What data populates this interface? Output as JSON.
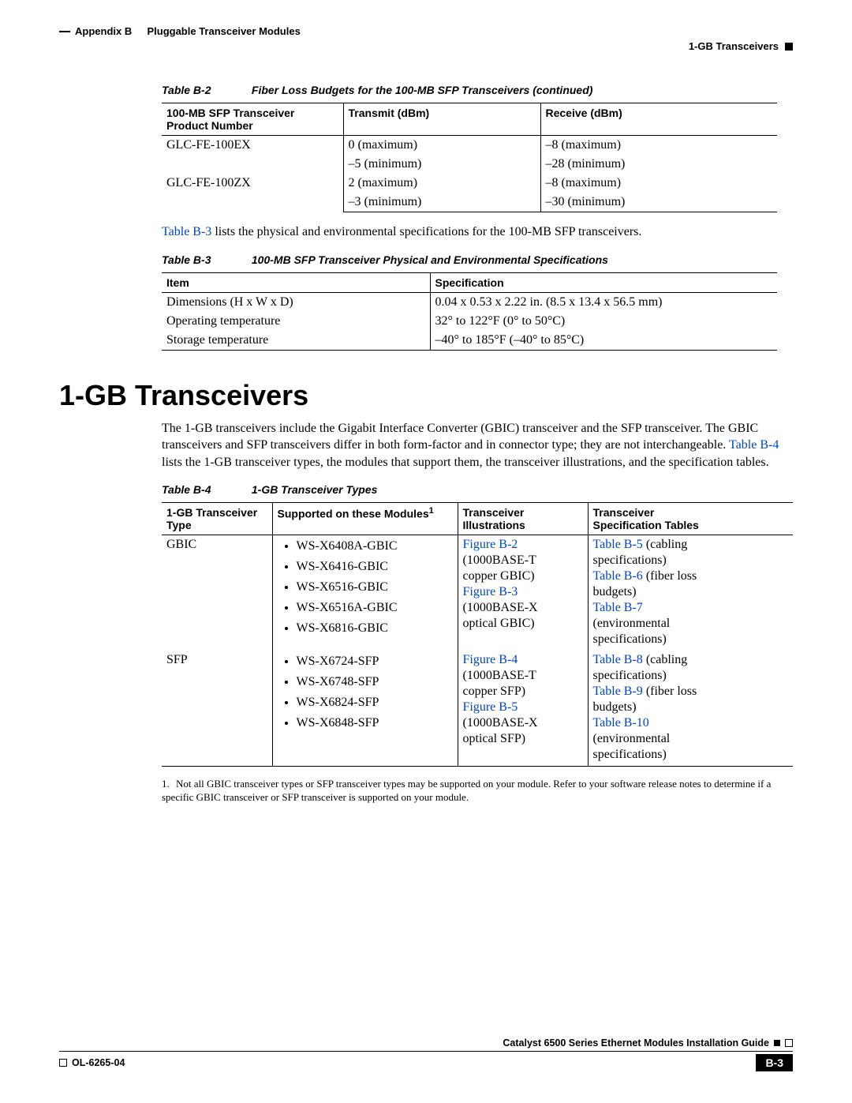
{
  "header": {
    "appendix": "Appendix B",
    "appendix_title": "Pluggable Transceiver Modules",
    "section": "1-GB Transceivers"
  },
  "table_b2": {
    "num": "Table B-2",
    "title": "Fiber Loss Budgets for the 100-MB SFP Transceivers (continued)",
    "headers": {
      "c1a": "100-MB SFP Transceiver",
      "c1b": "Product Number",
      "c2": "Transmit (dBm)",
      "c3": "Receive (dBm)"
    },
    "rows": [
      {
        "pn": "GLC-FE-100EX",
        "tx1": "0 (maximum)",
        "tx2": "–5 (minimum)",
        "rx1": "–8 (maximum)",
        "rx2": "–28 (minimum)"
      },
      {
        "pn": "GLC-FE-100ZX",
        "tx1": "2 (maximum)",
        "tx2": "–3 (minimum)",
        "rx1": "–8 (maximum)",
        "rx2": "–30 (minimum)"
      }
    ]
  },
  "para1": {
    "link": "Table B-3",
    "rest": " lists the physical and environmental specifications for the 100-MB SFP transceivers."
  },
  "table_b3": {
    "num": "Table B-3",
    "title": "100-MB SFP Transceiver Physical and Environmental Specifications",
    "headers": {
      "c1": "Item",
      "c2": "Specification"
    },
    "rows": [
      {
        "item": "Dimensions (H x W x D)",
        "spec": "0.04 x 0.53 x 2.22 in. (8.5 x 13.4 x 56.5 mm)"
      },
      {
        "item": "Operating temperature",
        "spec": "32° to 122°F (0° to 50°C)"
      },
      {
        "item": "Storage temperature",
        "spec": "–40° to 185°F (–40° to 85°C)"
      }
    ]
  },
  "section_heading": "1-GB Transceivers",
  "para2": {
    "t1": "The 1-GB transceivers include the Gigabit Interface Converter (GBIC) transceiver and the SFP transceiver. The GBIC transceivers and SFP transceivers differ in both form-factor and in connector type; they are not interchangeable. ",
    "link": "Table B-4",
    "t2": " lists the 1-GB transceiver types, the modules that support them, the transceiver illustrations, and the specification tables."
  },
  "table_b4": {
    "num": "Table B-4",
    "title": "1-GB Transceiver Types",
    "headers": {
      "c1a": "1-GB Transceiver",
      "c1b": "Type",
      "c2": "Supported on these Modules",
      "c3a": "Transceiver",
      "c3b": "Illustrations",
      "c4a": "Transceiver",
      "c4b": "Specification Tables"
    },
    "rows": {
      "gbic": {
        "type": "GBIC",
        "modules": [
          "WS-X6408A-GBIC",
          "WS-X6416-GBIC",
          "WS-X6516-GBIC",
          "WS-X6516A-GBIC",
          "WS-X6816-GBIC"
        ],
        "illus": {
          "l1": "Figure B-2",
          "d1a": "(1000BASE-T",
          "d1b": "copper GBIC)",
          "l2": "Figure B-3",
          "d2a": "(1000BASE-X",
          "d2b": "optical GBIC)"
        },
        "spec": {
          "l1": "Table B-5",
          "t1": " (cabling",
          "t1b": "specifications)",
          "l2": "Table B-6",
          "t2": " (fiber loss",
          "t2b": "budgets)",
          "l3": "Table B-7",
          "t3a": "(environmental",
          "t3b": "specifications)"
        }
      },
      "sfp": {
        "type": "SFP",
        "modules": [
          "WS-X6724-SFP",
          "WS-X6748-SFP",
          "WS-X6824-SFP",
          "WS-X6848-SFP"
        ],
        "illus": {
          "l1": "Figure B-4",
          "d1a": "(1000BASE-T",
          "d1b": "copper SFP)",
          "l2": "Figure B-5",
          "d2a": "(1000BASE-X",
          "d2b": "optical SFP)"
        },
        "spec": {
          "l1": "Table B-8",
          "t1": " (cabling",
          "t1b": "specifications)",
          "l2": "Table B-9",
          "t2": " (fiber loss",
          "t2b": "budgets)",
          "l3": "Table B-10",
          "t3a": "(environmental",
          "t3b": "specifications)"
        }
      }
    },
    "footnote_num": "1.",
    "footnote": "Not all GBIC transceiver types or SFP transceiver types may be supported on your module. Refer to your software release notes to determine if a specific GBIC transceiver or SFP transceiver is supported on your module."
  },
  "footer": {
    "guide": "Catalyst 6500 Series Ethernet Modules Installation Guide",
    "ol": "OL-6265-04",
    "page": "B-3"
  }
}
